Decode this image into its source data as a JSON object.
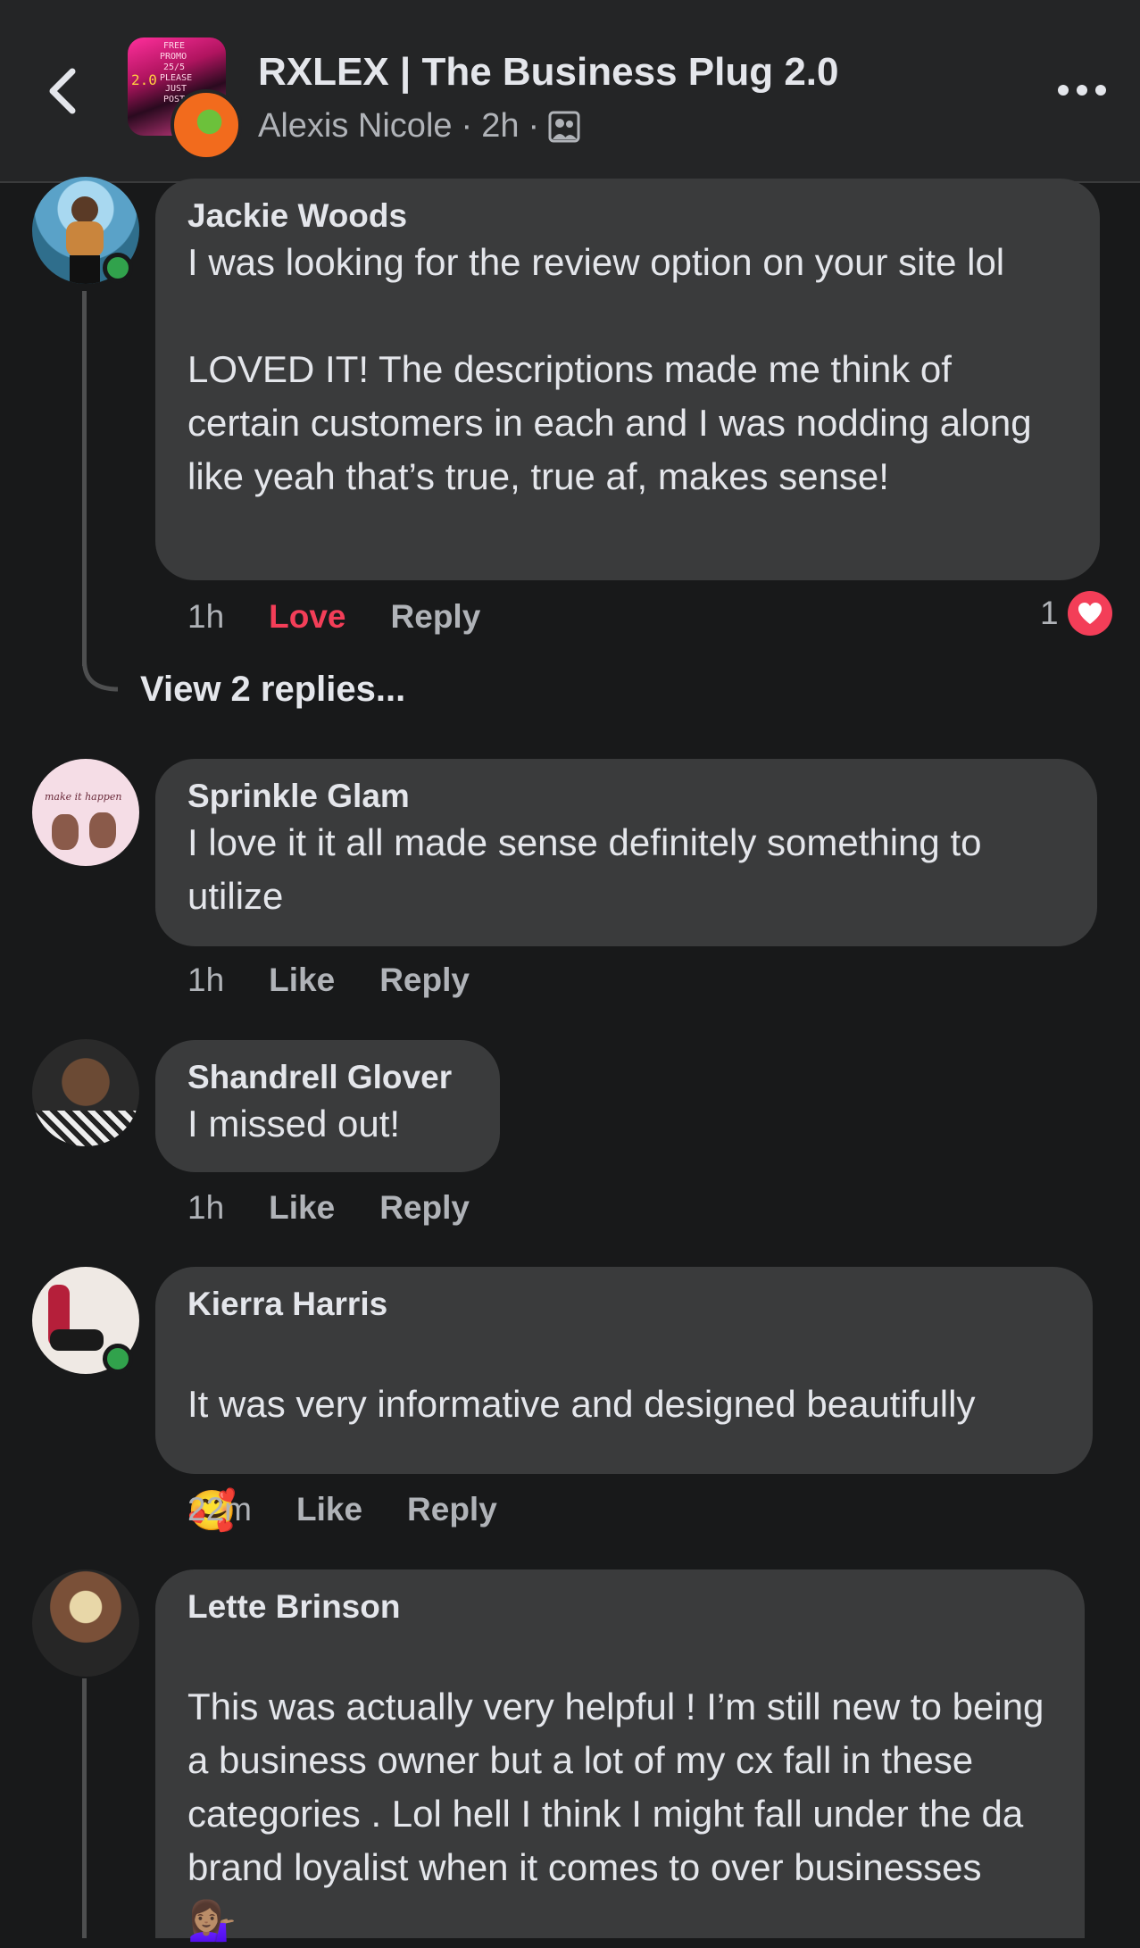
{
  "header": {
    "back_icon": "chevron-left-icon",
    "group_title": "RXLEX | The Business Plug 2.0",
    "author": "Alexis Nicole",
    "time": "2h",
    "privacy_icon": "group-members-icon",
    "more_icon": "more-horizontal-icon",
    "avatar_text": [
      "FREE",
      "PROMO",
      "25/5",
      "PLEASE",
      "JUST",
      "POST",
      "2.0"
    ]
  },
  "comments": [
    {
      "name": "Jackie Woods",
      "text": "I was looking for the review option on your site lol\n\nLOVED IT! The descriptions made me think of certain customers in each and I was nodding along like yeah that’s true, true af, makes sense!",
      "time": "1h",
      "reaction_label": "Love",
      "reply_label": "Reply",
      "reaction_count": "1",
      "online": true
    },
    {
      "name": "Sprinkle Glam",
      "text": "I love it it all made sense definitely something to utilize",
      "time": "1h",
      "reaction_label": "Like",
      "reply_label": "Reply",
      "online": false,
      "avatar_text": "make it happen"
    },
    {
      "name": "Shandrell Glover",
      "text": "I missed out!",
      "time": "1h",
      "reaction_label": "Like",
      "reply_label": "Reply",
      "online": false
    },
    {
      "name": "Kierra Harris",
      "text": "It was very informative and designed beautifully",
      "emoji": "🥰",
      "time": "22m",
      "reaction_label": "Like",
      "reply_label": "Reply",
      "online": true
    },
    {
      "name": "Lette Brinson",
      "text": "This was actually very helpful ! I’m still new to being a business owner but a lot of my cx fall in these categories . Lol hell I think I might fall under the da brand loyalist when it comes to over businesses",
      "emoji": "💁🏽‍♀️",
      "online": false
    }
  ],
  "view_replies": "View 2 replies...",
  "colors": {
    "background": "#18191a",
    "bubble": "#3a3b3c",
    "love": "#f33e58",
    "online": "#31a24c",
    "secondary_text": "#b0b3b8"
  }
}
